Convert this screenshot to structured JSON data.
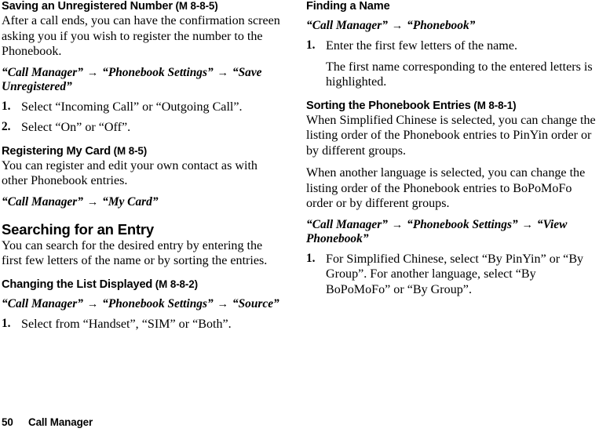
{
  "document": {
    "page_number": "50",
    "footer_section": "Call Manager"
  },
  "left_column": {
    "section1": {
      "heading_main": "Saving an Unregistered Number",
      "heading_code": " (M 8-8-5)",
      "paragraph": "After a call ends, you can have the confirmation screen asking you if you wish to register the number to the Phonebook.",
      "path": {
        "part1": "“Call Manager”",
        "arrow1": "→",
        "part2": "“Phonebook Settings”",
        "arrow2": "→",
        "part3": "“Save Unregistered”"
      },
      "steps": [
        {
          "num": "1.",
          "text": "Select “Incoming Call” or “Outgoing Call”."
        },
        {
          "num": "2.",
          "text": "Select “On” or “Off”."
        }
      ]
    },
    "section2": {
      "heading_main": "Registering My Card",
      "heading_code": " (M 8-5)",
      "paragraph": "You can register and edit your own contact as with other Phonebook entries.",
      "path": {
        "part1": "“Call Manager”",
        "arrow1": "→",
        "part2": "“My Card”"
      }
    },
    "section3": {
      "title": "Searching for an Entry",
      "paragraph": "You can search for the desired entry by entering the first few letters of the name or by sorting the entries.",
      "subsection": {
        "heading_main": "Changing the List Displayed",
        "heading_code": " (M 8-8-2)",
        "path": {
          "part1": "“Call Manager”",
          "arrow1": "→",
          "part2": "“Phonebook Settings”",
          "arrow2": "→",
          "part3": "“Source”"
        },
        "steps": [
          {
            "num": "1.",
            "text": "Select from “Handset”, “SIM” or “Both”."
          }
        ]
      }
    }
  },
  "right_column": {
    "section1": {
      "heading_main": "Finding a Name",
      "heading_code": "",
      "path": {
        "part1": "“Call Manager”",
        "arrow1": "→",
        "part2": "“Phonebook”"
      },
      "steps": [
        {
          "num": "1.",
          "text": "Enter the first few letters of the name."
        }
      ],
      "note": "The first name corresponding to the entered letters is highlighted."
    },
    "section2": {
      "heading_main": "Sorting the Phonebook Entries",
      "heading_code": " (M 8-8-1)",
      "paragraph1": "When Simplified Chinese is selected, you can change the listing order of the Phonebook entries to PinYin order or by different groups.",
      "paragraph2": "When another language is selected, you can change the listing order of the Phonebook entries to BoPoMoFo order or by different groups.",
      "path": {
        "part1": "“Call Manager”",
        "arrow1": "→",
        "part2": "“Phonebook Settings”",
        "arrow2": "→",
        "part3": "“View Phonebook”"
      },
      "steps": [
        {
          "num": "1.",
          "text": "For Simplified Chinese, select “By PinYin” or “By Group”. For another language, select “By BoPoMoFo” or “By Group”."
        }
      ]
    }
  }
}
